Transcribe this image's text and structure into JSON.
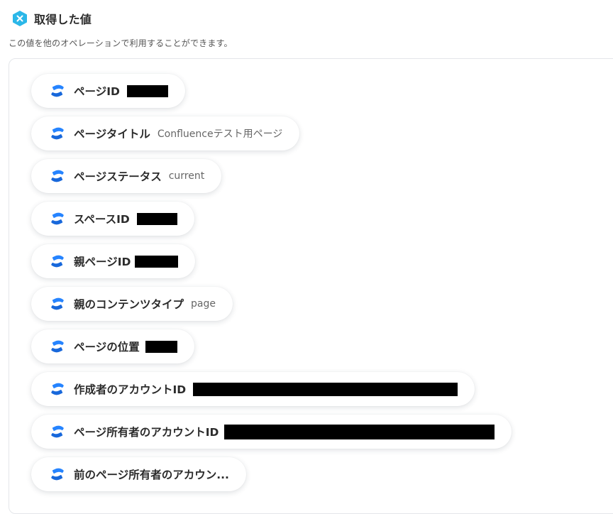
{
  "header": {
    "title": "取得した値",
    "icon": "close-badge-icon",
    "accent_color": "#2bb7e8"
  },
  "description": "この値を他のオペレーションで利用することができます。",
  "items": [
    {
      "label": "ページID",
      "value": "",
      "redacted": true,
      "icon": "confluence-icon"
    },
    {
      "label": "ページタイトル",
      "value": "Confluenceテスト用ページ",
      "redacted": false,
      "icon": "confluence-icon"
    },
    {
      "label": "ページステータス",
      "value": "current",
      "redacted": false,
      "icon": "confluence-icon"
    },
    {
      "label": "スペースID",
      "value": "",
      "redacted": true,
      "icon": "confluence-icon"
    },
    {
      "label": "親ページID",
      "value": "",
      "redacted": true,
      "icon": "confluence-icon"
    },
    {
      "label": "親のコンテンツタイプ",
      "value": "page",
      "redacted": false,
      "icon": "confluence-icon"
    },
    {
      "label": "ページの位置",
      "value": "",
      "redacted": true,
      "icon": "confluence-icon"
    },
    {
      "label": "作成者のアカウントID",
      "value": "",
      "redacted": true,
      "icon": "confluence-icon"
    },
    {
      "label": "ページ所有者のアカウントID",
      "value": "",
      "redacted": true,
      "icon": "confluence-icon"
    },
    {
      "label": "前のページ所有者のアカウン...",
      "value": "",
      "redacted": false,
      "icon": "confluence-icon"
    }
  ],
  "colors": {
    "confluence_blue": "#1868db",
    "confluence_blue_light": "#2684ff",
    "redaction": "#000000"
  }
}
